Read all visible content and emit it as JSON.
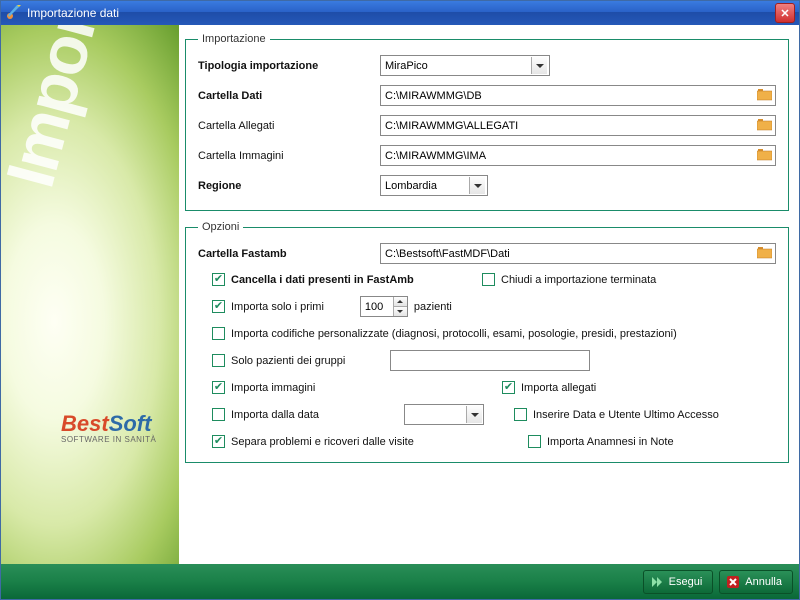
{
  "window": {
    "title": "Importazione dati"
  },
  "sidebar": {
    "watermark": "Import",
    "brand1": "Best",
    "brand2": "Soft",
    "brand_sub": "SOFTWARE IN SANITÀ"
  },
  "importazione": {
    "legend": "Importazione",
    "tipologia_label": "Tipologia importazione",
    "tipologia_value": "MiraPico",
    "cartella_dati_label": "Cartella Dati",
    "cartella_dati_value": "C:\\MIRAWMMG\\DB",
    "cartella_allegati_label": "Cartella Allegati",
    "cartella_allegati_value": "C:\\MIRAWMMG\\ALLEGATI",
    "cartella_immagini_label": "Cartella Immagini",
    "cartella_immagini_value": "C:\\MIRAWMMG\\IMA",
    "regione_label": "Regione",
    "regione_value": "Lombardia"
  },
  "opzioni": {
    "legend": "Opzioni",
    "cartella_fastamb_label": "Cartella Fastamb",
    "cartella_fastamb_value": "C:\\Bestsoft\\FastMDF\\Dati",
    "cancella_dati": {
      "checked": true,
      "label": "Cancella i dati presenti in FastAmb"
    },
    "chiudi_term": {
      "checked": false,
      "label": "Chiudi a importazione terminata"
    },
    "importa_primi": {
      "checked": true,
      "label": "Importa solo i primi",
      "value": "100",
      "suffix": "pazienti"
    },
    "importa_codifiche": {
      "checked": false,
      "label": "Importa codifiche personalizzate (diagnosi, protocolli, esami, posologie, presidi, prestazioni)"
    },
    "solo_gruppi": {
      "checked": false,
      "label": "Solo pazienti dei gruppi"
    },
    "importa_immagini": {
      "checked": true,
      "label": "Importa immagini"
    },
    "importa_allegati": {
      "checked": true,
      "label": "Importa allegati"
    },
    "importa_dalla_data": {
      "checked": false,
      "label": "Importa dalla data"
    },
    "inserire_data": {
      "checked": false,
      "label": "Inserire Data e Utente Ultimo Accesso"
    },
    "separa_problemi": {
      "checked": true,
      "label": "Separa problemi e ricoveri dalle visite"
    },
    "importa_anamnesi": {
      "checked": false,
      "label": "Importa Anamnesi in Note"
    }
  },
  "footer": {
    "esegui": "Esegui",
    "annulla": "Annulla"
  }
}
